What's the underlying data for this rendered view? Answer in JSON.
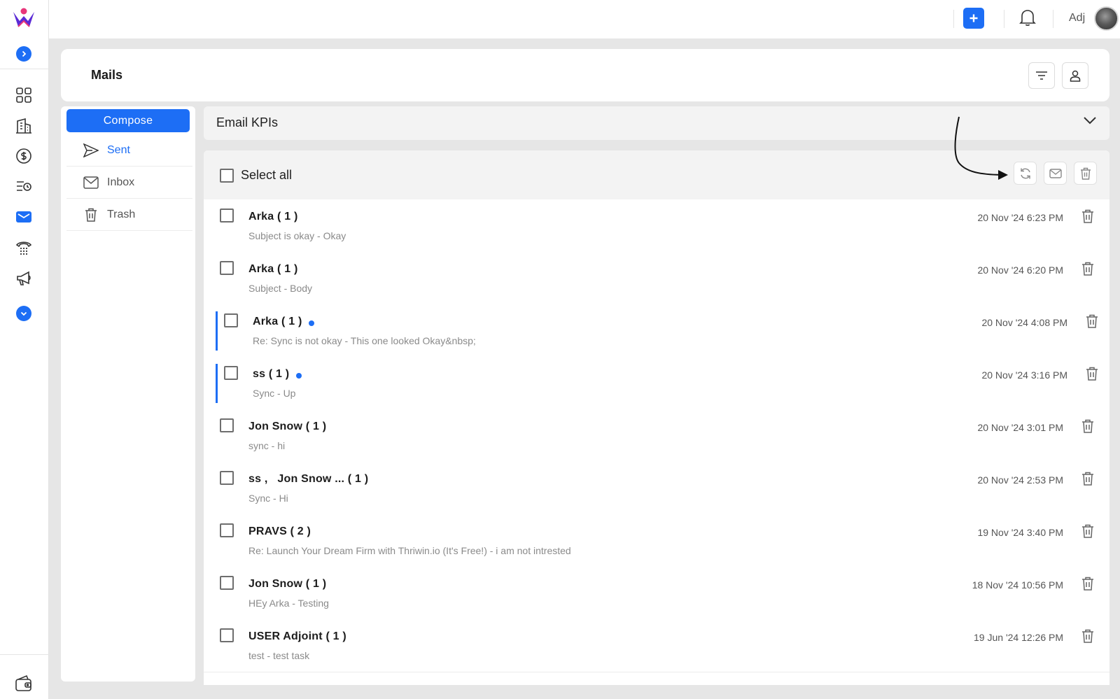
{
  "app": {
    "brand": "Thriwin"
  },
  "topbar": {
    "user_name": "Adj"
  },
  "header": {
    "title": "Mails"
  },
  "folders": {
    "compose_label": "Compose",
    "items": [
      {
        "label": "Sent",
        "icon": "send-icon",
        "active": true
      },
      {
        "label": "Inbox",
        "icon": "envelope-icon",
        "active": false
      },
      {
        "label": "Trash",
        "icon": "trash-icon",
        "active": false
      }
    ]
  },
  "kpi": {
    "title": "Email KPIs"
  },
  "list": {
    "select_all_label": "Select all",
    "mails": [
      {
        "sender": "Arka ( 1 )",
        "preview": "Subject is okay -  Okay",
        "date": "20 Nov '24 6:23 PM",
        "unread": false
      },
      {
        "sender": "Arka ( 1 )",
        "preview": "Subject -  Body",
        "date": "20 Nov '24 6:20 PM",
        "unread": false
      },
      {
        "sender": "Arka ( 1 )",
        "preview": "Re: Sync is not okay -  This one looked Okay&nbsp;",
        "date": "20 Nov '24 4:08 PM",
        "unread": true
      },
      {
        "sender": "ss ( 1 )",
        "preview": "Sync -  Up",
        "date": "20 Nov '24 3:16 PM",
        "unread": true
      },
      {
        "sender": "Jon Snow ( 1 )",
        "preview": "sync -  hi",
        "date": "20 Nov '24 3:01 PM",
        "unread": false
      },
      {
        "sender": "ss ,   Jon Snow ... ( 1 )",
        "preview": "Sync -  Hi",
        "date": "20 Nov '24 2:53 PM",
        "unread": false
      },
      {
        "sender": "PRAVS ( 2 )",
        "preview": "Re: Launch Your Dream Firm with Thriwin.io (It's Free!) -  i am not intrested",
        "date": "19 Nov '24 3:40 PM",
        "unread": false
      },
      {
        "sender": "Jon Snow ( 1 )",
        "preview": "HEy Arka -  Testing",
        "date": "18 Nov '24 10:56 PM",
        "unread": false
      },
      {
        "sender": "USER Adjoint ( 1 )",
        "preview": "test -  test task",
        "date": "19 Jun '24 12:26 PM",
        "unread": false
      }
    ]
  },
  "colors": {
    "accent": "#1d6ef5",
    "background": "#e6e6e6",
    "muted_text": "#8a8a8a"
  }
}
